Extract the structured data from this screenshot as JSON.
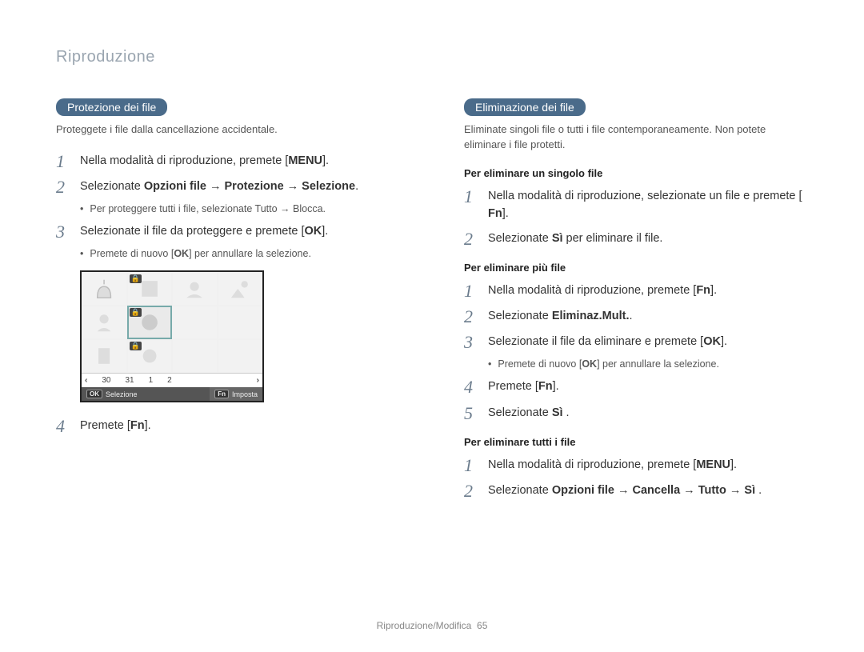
{
  "header": "Riproduzione",
  "left": {
    "pill": "Protezione dei file",
    "intro": "Proteggete i file dalla cancellazione accidentale.",
    "steps": [
      {
        "n": "1",
        "text": "Nella modalità di riproduzione, premete [",
        "key": "MENU",
        "after": "]."
      },
      {
        "n": "2",
        "text": "Selezionate ",
        "bold": "Opzioni file → Protezione → Selezione",
        "after": "."
      },
      {
        "n": "3",
        "text": "Selezionate il file da proteggere e premete [",
        "key": "OK",
        "after": "]."
      },
      {
        "n": "4",
        "text": "Premete [",
        "key": "Fn",
        "after": "]."
      }
    ],
    "bullet1": "Per proteggere tutti i file, selezionate Tutto → Blocca.",
    "bullet2_pre": "Premete di nuovo [",
    "bullet2_key": "OK",
    "bullet2_post": "] per annullare la selezione.",
    "thumbbar": {
      "dates": [
        "30",
        "31",
        "1",
        "2"
      ],
      "ok": "Selezione",
      "fn": "Imposta",
      "ok_key": "OK",
      "fn_key": "Fn",
      "left_arrow": "‹",
      "right_arrow": "›"
    }
  },
  "right": {
    "pill": "Eliminazione dei file",
    "intro": "Eliminate singoli file o tutti i file contemporaneamente. Non potete eliminare i file protetti.",
    "sec1": {
      "title": "Per eliminare un singolo file",
      "steps": [
        {
          "n": "1",
          "text": "Nella modalità di riproduzione, selezionate un file e premete [",
          "key": "Fn",
          "after": "]."
        },
        {
          "n": "2",
          "text": "Selezionate ",
          "bold": "Sì",
          "after": " per eliminare il file."
        }
      ]
    },
    "sec2": {
      "title": "Per eliminare più file",
      "steps": [
        {
          "n": "1",
          "text": "Nella modalità di riproduzione, premete [",
          "key": "Fn",
          "after": "]."
        },
        {
          "n": "2",
          "text": "Selezionate ",
          "bold": "Eliminaz.Mult.",
          "after": "."
        },
        {
          "n": "3",
          "text": "Selezionate il file da eliminare e premete [",
          "key": "OK",
          "after": "]."
        },
        {
          "n": "4",
          "text": "Premete [",
          "key": "Fn",
          "after": "]."
        },
        {
          "n": "5",
          "text": "Selezionate ",
          "bold": "Sì",
          "after": " ."
        }
      ],
      "bullet_pre": "Premete di nuovo [",
      "bullet_key": "OK",
      "bullet_post": "] per annullare la selezione."
    },
    "sec3": {
      "title": "Per eliminare tutti i file",
      "steps": [
        {
          "n": "1",
          "text": "Nella modalità di riproduzione, premete [",
          "key": "MENU",
          "after": "]."
        },
        {
          "n": "2",
          "text": "Selezionate ",
          "bold": "Opzioni file → Cancella → Tutto → Sì",
          "after": " ."
        }
      ]
    }
  },
  "footer": {
    "section": "Riproduzione/Modifica",
    "page": "65"
  }
}
